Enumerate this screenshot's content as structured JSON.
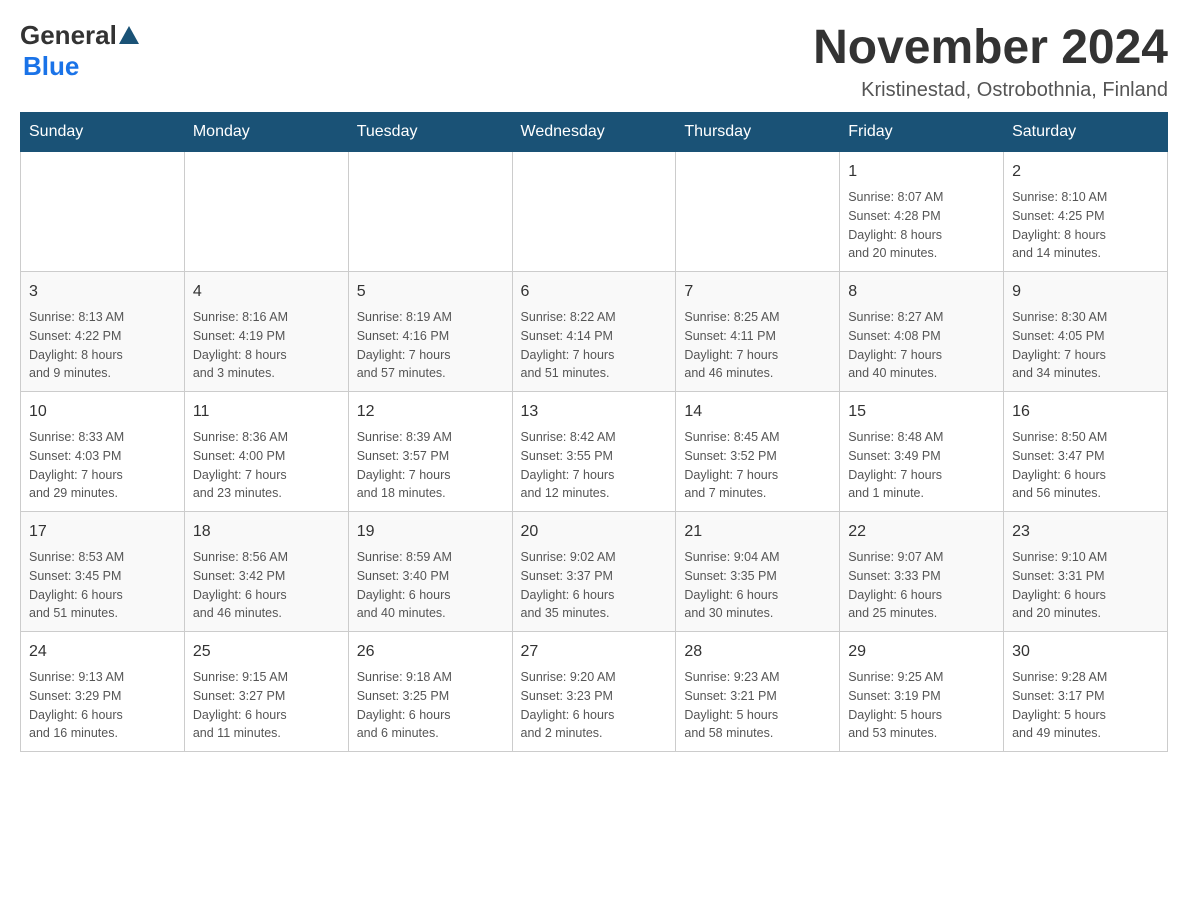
{
  "header": {
    "logo_general": "General",
    "logo_blue": "Blue",
    "month_title": "November 2024",
    "location": "Kristinestad, Ostrobothnia, Finland"
  },
  "weekdays": [
    "Sunday",
    "Monday",
    "Tuesday",
    "Wednesday",
    "Thursday",
    "Friday",
    "Saturday"
  ],
  "weeks": [
    {
      "days": [
        {
          "number": "",
          "info": ""
        },
        {
          "number": "",
          "info": ""
        },
        {
          "number": "",
          "info": ""
        },
        {
          "number": "",
          "info": ""
        },
        {
          "number": "",
          "info": ""
        },
        {
          "number": "1",
          "info": "Sunrise: 8:07 AM\nSunset: 4:28 PM\nDaylight: 8 hours\nand 20 minutes."
        },
        {
          "number": "2",
          "info": "Sunrise: 8:10 AM\nSunset: 4:25 PM\nDaylight: 8 hours\nand 14 minutes."
        }
      ]
    },
    {
      "days": [
        {
          "number": "3",
          "info": "Sunrise: 8:13 AM\nSunset: 4:22 PM\nDaylight: 8 hours\nand 9 minutes."
        },
        {
          "number": "4",
          "info": "Sunrise: 8:16 AM\nSunset: 4:19 PM\nDaylight: 8 hours\nand 3 minutes."
        },
        {
          "number": "5",
          "info": "Sunrise: 8:19 AM\nSunset: 4:16 PM\nDaylight: 7 hours\nand 57 minutes."
        },
        {
          "number": "6",
          "info": "Sunrise: 8:22 AM\nSunset: 4:14 PM\nDaylight: 7 hours\nand 51 minutes."
        },
        {
          "number": "7",
          "info": "Sunrise: 8:25 AM\nSunset: 4:11 PM\nDaylight: 7 hours\nand 46 minutes."
        },
        {
          "number": "8",
          "info": "Sunrise: 8:27 AM\nSunset: 4:08 PM\nDaylight: 7 hours\nand 40 minutes."
        },
        {
          "number": "9",
          "info": "Sunrise: 8:30 AM\nSunset: 4:05 PM\nDaylight: 7 hours\nand 34 minutes."
        }
      ]
    },
    {
      "days": [
        {
          "number": "10",
          "info": "Sunrise: 8:33 AM\nSunset: 4:03 PM\nDaylight: 7 hours\nand 29 minutes."
        },
        {
          "number": "11",
          "info": "Sunrise: 8:36 AM\nSunset: 4:00 PM\nDaylight: 7 hours\nand 23 minutes."
        },
        {
          "number": "12",
          "info": "Sunrise: 8:39 AM\nSunset: 3:57 PM\nDaylight: 7 hours\nand 18 minutes."
        },
        {
          "number": "13",
          "info": "Sunrise: 8:42 AM\nSunset: 3:55 PM\nDaylight: 7 hours\nand 12 minutes."
        },
        {
          "number": "14",
          "info": "Sunrise: 8:45 AM\nSunset: 3:52 PM\nDaylight: 7 hours\nand 7 minutes."
        },
        {
          "number": "15",
          "info": "Sunrise: 8:48 AM\nSunset: 3:49 PM\nDaylight: 7 hours\nand 1 minute."
        },
        {
          "number": "16",
          "info": "Sunrise: 8:50 AM\nSunset: 3:47 PM\nDaylight: 6 hours\nand 56 minutes."
        }
      ]
    },
    {
      "days": [
        {
          "number": "17",
          "info": "Sunrise: 8:53 AM\nSunset: 3:45 PM\nDaylight: 6 hours\nand 51 minutes."
        },
        {
          "number": "18",
          "info": "Sunrise: 8:56 AM\nSunset: 3:42 PM\nDaylight: 6 hours\nand 46 minutes."
        },
        {
          "number": "19",
          "info": "Sunrise: 8:59 AM\nSunset: 3:40 PM\nDaylight: 6 hours\nand 40 minutes."
        },
        {
          "number": "20",
          "info": "Sunrise: 9:02 AM\nSunset: 3:37 PM\nDaylight: 6 hours\nand 35 minutes."
        },
        {
          "number": "21",
          "info": "Sunrise: 9:04 AM\nSunset: 3:35 PM\nDaylight: 6 hours\nand 30 minutes."
        },
        {
          "number": "22",
          "info": "Sunrise: 9:07 AM\nSunset: 3:33 PM\nDaylight: 6 hours\nand 25 minutes."
        },
        {
          "number": "23",
          "info": "Sunrise: 9:10 AM\nSunset: 3:31 PM\nDaylight: 6 hours\nand 20 minutes."
        }
      ]
    },
    {
      "days": [
        {
          "number": "24",
          "info": "Sunrise: 9:13 AM\nSunset: 3:29 PM\nDaylight: 6 hours\nand 16 minutes."
        },
        {
          "number": "25",
          "info": "Sunrise: 9:15 AM\nSunset: 3:27 PM\nDaylight: 6 hours\nand 11 minutes."
        },
        {
          "number": "26",
          "info": "Sunrise: 9:18 AM\nSunset: 3:25 PM\nDaylight: 6 hours\nand 6 minutes."
        },
        {
          "number": "27",
          "info": "Sunrise: 9:20 AM\nSunset: 3:23 PM\nDaylight: 6 hours\nand 2 minutes."
        },
        {
          "number": "28",
          "info": "Sunrise: 9:23 AM\nSunset: 3:21 PM\nDaylight: 5 hours\nand 58 minutes."
        },
        {
          "number": "29",
          "info": "Sunrise: 9:25 AM\nSunset: 3:19 PM\nDaylight: 5 hours\nand 53 minutes."
        },
        {
          "number": "30",
          "info": "Sunrise: 9:28 AM\nSunset: 3:17 PM\nDaylight: 5 hours\nand 49 minutes."
        }
      ]
    }
  ]
}
